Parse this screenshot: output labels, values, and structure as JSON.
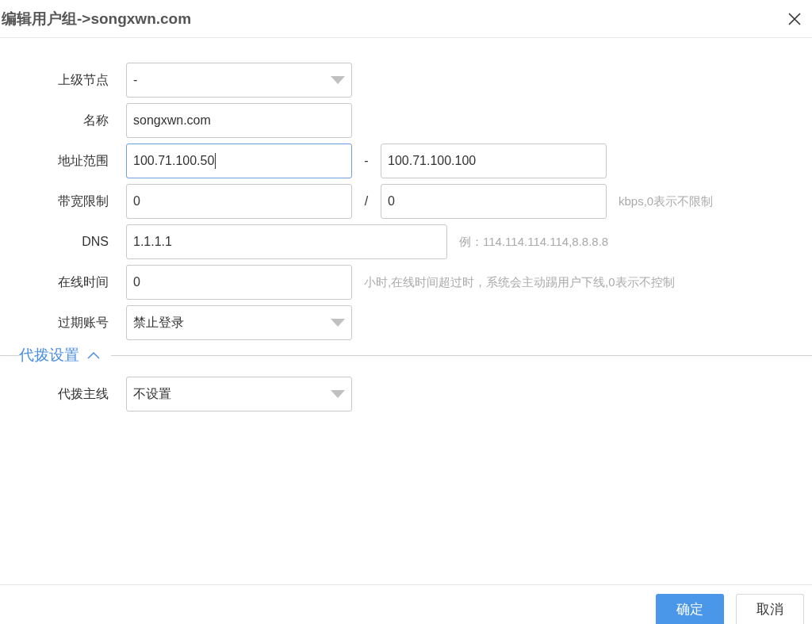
{
  "dialog": {
    "title": "编辑用户组->songxwn.com"
  },
  "rows": [
    {
      "label": "上级节点",
      "kind": "select",
      "inputs": [
        {
          "value": "-",
          "focused": false
        }
      ]
    },
    {
      "label": "名称",
      "kind": "text",
      "inputs": [
        {
          "value": "songxwn.com",
          "focused": false
        }
      ]
    },
    {
      "label": "地址范围",
      "kind": "pair",
      "separator": "-",
      "inputs": [
        {
          "value": "100.71.100.50",
          "focused": true
        },
        {
          "value": "100.71.100.100",
          "focused": false
        }
      ]
    },
    {
      "label": "带宽限制",
      "kind": "pair",
      "separator": "/",
      "hint": "kbps,0表示不限制",
      "inputs": [
        {
          "value": "0",
          "focused": false
        },
        {
          "value": "0",
          "focused": false
        }
      ]
    },
    {
      "label": "DNS",
      "kind": "wide",
      "hint": "例：114.114.114.114,8.8.8.8",
      "inputs": [
        {
          "value": "1.1.1.1",
          "focused": false
        }
      ]
    },
    {
      "label": "在线时间",
      "kind": "text",
      "hint": "小时,在线时间超过时，系统会主动踢用户下线,0表示不控制",
      "inputs": [
        {
          "value": "0",
          "focused": false
        }
      ]
    },
    {
      "label": "过期账号",
      "kind": "select",
      "inputs": [
        {
          "value": "禁止登录",
          "focused": false
        }
      ]
    }
  ],
  "section": {
    "title": "代拨设置",
    "expanded": true,
    "rows": [
      {
        "label": "代拨主线",
        "kind": "select",
        "inputs": [
          {
            "value": "不设置",
            "focused": false
          }
        ]
      }
    ]
  },
  "buttons": [
    {
      "label": "确定",
      "kind": "primary"
    },
    {
      "label": "取消",
      "kind": "default"
    }
  ]
}
